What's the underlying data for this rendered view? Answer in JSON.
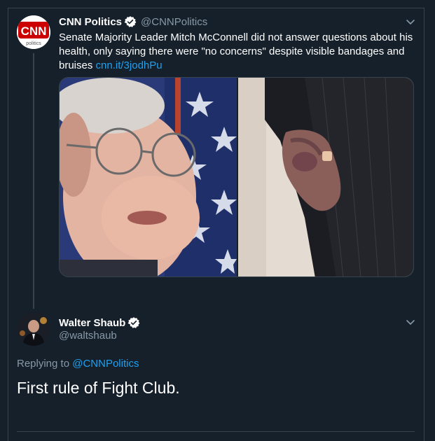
{
  "original_tweet": {
    "display_name": "CNN Politics",
    "handle": "@CNNPolitics",
    "avatar_logo": "CNN",
    "avatar_sublabel": "politics",
    "text": "Senate Majority Leader Mitch McConnell did not answer questions about his health, only saying there were \"no concerns\" despite visible bandages and bruises ",
    "link": "cnn.it/3jodhPu",
    "verified_icon": "verified-badge-icon",
    "menu_icon": "chevron-down-icon"
  },
  "media": {
    "left_image": "portrait-photo",
    "right_image": "bruised-hand-photo"
  },
  "reply_tweet": {
    "display_name": "Walter Shaub",
    "handle": "@waltshaub",
    "replying_prefix": "Replying to ",
    "replying_to": "@CNNPolitics",
    "text": "First rule of Fight Club.",
    "verified_icon": "verified-badge-icon",
    "menu_icon": "chevron-down-icon"
  },
  "colors": {
    "background": "#15202b",
    "link": "#1da1f2",
    "muted": "#8899a6",
    "border": "#38444d",
    "cnn_red": "#cc0000"
  }
}
